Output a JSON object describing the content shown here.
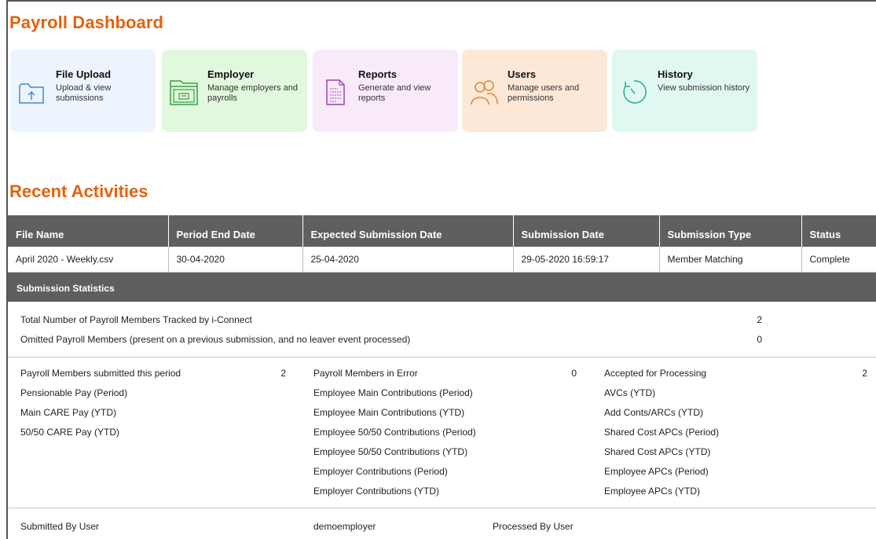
{
  "page_title": "Payroll Dashboard",
  "cards": [
    {
      "title": "File Upload",
      "desc": "Upload & view submissions",
      "icon": "file-upload-icon",
      "bg": "#eef4fd",
      "color": "#3d8ad6"
    },
    {
      "title": "Employer",
      "desc": "Manage employers and payrolls",
      "icon": "employer-folder-icon",
      "bg": "#e2f8de",
      "color": "#3aa040"
    },
    {
      "title": "Reports",
      "desc": "Generate and view reports",
      "icon": "report-document-icon",
      "bg": "#f9eafa",
      "color": "#9b45b0"
    },
    {
      "title": "Users",
      "desc": "Manage users and permissions",
      "icon": "users-icon",
      "bg": "#fde8d8",
      "color": "#e0822e"
    },
    {
      "title": "History",
      "desc": "View submission history",
      "icon": "history-icon",
      "bg": "#e1f8f2",
      "color": "#21b08f"
    }
  ],
  "recent_title": "Recent Activities",
  "table": {
    "headers": [
      "File Name",
      "Period End Date",
      "Expected Submission Date",
      "Submission Date",
      "Submission Type",
      "Status"
    ],
    "rows": [
      [
        "April 2020 - Weekly.csv",
        "30-04-2020",
        "25-04-2020",
        "29-05-2020 16:59:17",
        "Member Matching",
        "Complete"
      ]
    ]
  },
  "stats": {
    "heading": "Submission Statistics",
    "total_label": "Total Number of Payroll Members Tracked by i-Connect",
    "total_value": "2",
    "omitted_label": "Omitted Payroll Members (present on a previous submission, and no leaver event processed)",
    "omitted_value": "0",
    "col1": [
      {
        "label": "Payroll Members submitted this period",
        "value": "2"
      },
      {
        "label": "Pensionable Pay (Period)",
        "value": ""
      },
      {
        "label": "Main CARE Pay (YTD)",
        "value": ""
      },
      {
        "label": "50/50 CARE Pay (YTD)",
        "value": ""
      }
    ],
    "col2": [
      {
        "label": "Payroll Members in Error",
        "value": "0"
      },
      {
        "label": "Employee Main Contributions (Period)",
        "value": ""
      },
      {
        "label": "Employee Main Contributions (YTD)",
        "value": ""
      },
      {
        "label": "Employee 50/50 Contributions (Period)",
        "value": ""
      },
      {
        "label": "Employee 50/50 Contributions (YTD)",
        "value": ""
      },
      {
        "label": "Employer Contributions (Period)",
        "value": ""
      },
      {
        "label": "Employer Contributions (YTD)",
        "value": ""
      }
    ],
    "col3": [
      {
        "label": "Accepted for Processing",
        "value": "2"
      },
      {
        "label": "AVCs (YTD)",
        "value": ""
      },
      {
        "label": "Add Conts/ARCs (YTD)",
        "value": ""
      },
      {
        "label": "Shared Cost APCs (Period)",
        "value": ""
      },
      {
        "label": "Shared Cost APCs (YTD)",
        "value": ""
      },
      {
        "label": "Employee APCs (Period)",
        "value": ""
      },
      {
        "label": "Employee APCs (YTD)",
        "value": ""
      }
    ],
    "submitted_by_label": "Submitted By User",
    "submitted_by_value": "demoemployer",
    "processed_by_label": "Processed By User",
    "processed_by_value": ""
  }
}
